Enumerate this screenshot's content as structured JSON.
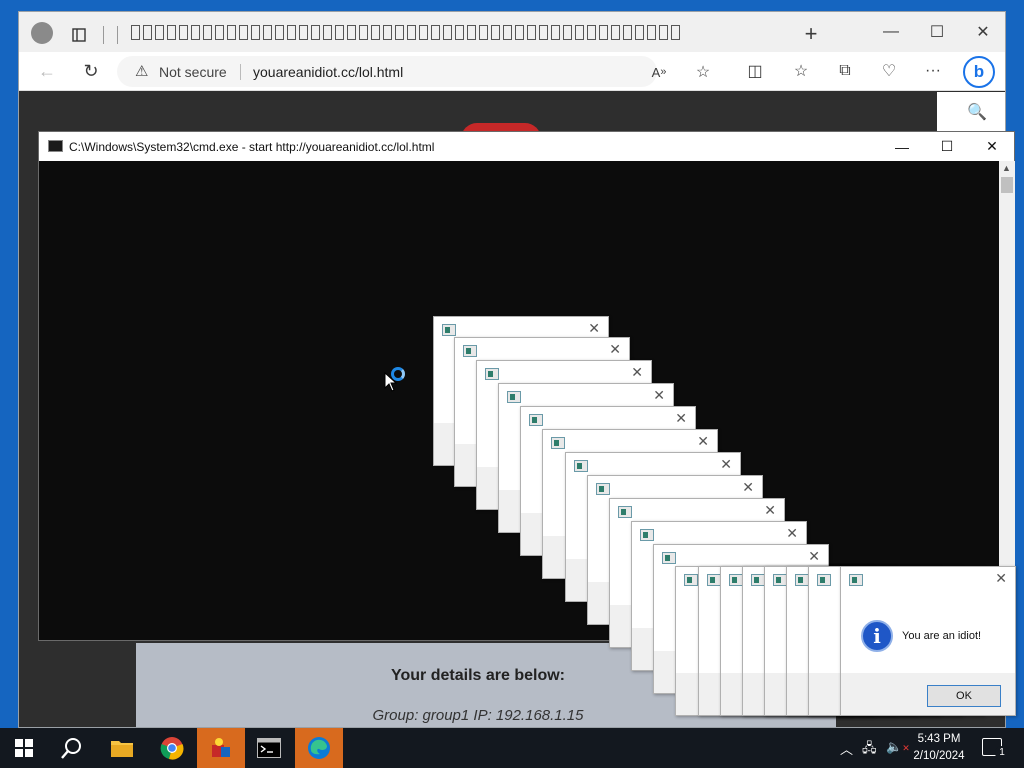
{
  "browser": {
    "tab_title_glyph_count": 46,
    "address": {
      "security_label": "Not secure",
      "url": "youareanidiot.cc/lol.html"
    },
    "page": {
      "details_title": "Your details are below:",
      "details_line": "Group: group1   IP: 192.168.1.15"
    }
  },
  "cmd": {
    "title": "C:\\Windows\\System32\\cmd.exe - start  http://youareanidiot.cc/lol.html"
  },
  "popups": {
    "message": "You are an idiot!",
    "ok_label": "OK"
  },
  "taskbar": {
    "apps": [
      "start",
      "search",
      "file-explorer",
      "chrome",
      "cube-app",
      "command-prompt",
      "edge"
    ],
    "time": "5:43 PM",
    "date": "2/10/2024",
    "notification_count": "1"
  },
  "icons": {
    "tab_actions": "tab-actions-icon",
    "info": "info-icon",
    "warning": "warning-icon"
  },
  "colors": {
    "accent": "#1565c0",
    "taskbar_active": "#d86a1e",
    "info_blue": "#1f57c7"
  }
}
